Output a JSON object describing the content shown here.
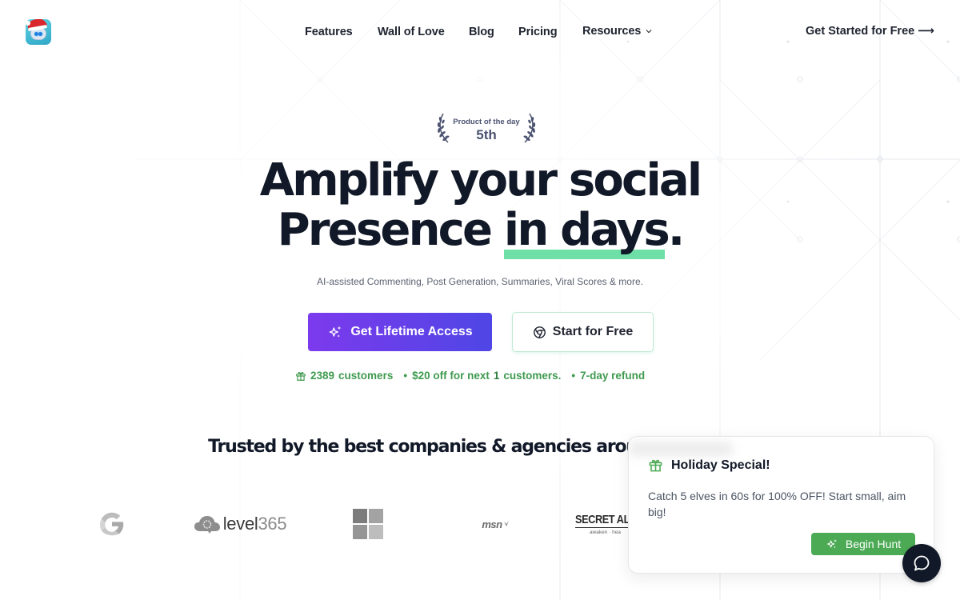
{
  "header": {
    "logo_alt": "App logo (robot with Santa hat)",
    "nav": [
      {
        "label": "Features"
      },
      {
        "label": "Wall of Love"
      },
      {
        "label": "Blog"
      },
      {
        "label": "Pricing"
      },
      {
        "label": "Resources",
        "has_dropdown": true
      }
    ],
    "cta_label": "Get Started for Free",
    "cta_arrow": "⟶"
  },
  "badge": {
    "title": "Product of the day",
    "rank": "5th"
  },
  "hero": {
    "title_line1": "Amplify your social",
    "title_line2_plain": "Presence ",
    "title_line2_highlight": "in days",
    "title_line2_end": ".",
    "highlight_color": "#6ee0a7",
    "subtitle": "AI-assisted Commenting, Post Generation, Summaries, Viral Scores & more.",
    "primary_button": "Get Lifetime Access",
    "secondary_button": "Start for Free",
    "primary_gradient": [
      "#7c3aed",
      "#4f46e5"
    ]
  },
  "stats": {
    "customers_count": "2389",
    "customers_label": "customers",
    "discount_prefix": "$20 off for next",
    "discount_count": "1",
    "discount_suffix": "customers.",
    "refund": "7-day refund",
    "bullet": "•",
    "color": "#3f9a4f"
  },
  "trusted": {
    "heading": "Trusted by the best companies & agencies around the world",
    "logos": [
      {
        "name": "Google",
        "text": "G"
      },
      {
        "name": "level365",
        "text_main": "level",
        "text_num": "365"
      },
      {
        "name": "Microsoft"
      },
      {
        "name": "MSN",
        "text": "msn"
      },
      {
        "name": "Secret Alchemist",
        "text": "SECRET AL",
        "tagline": "awaken · hea"
      },
      {
        "name": "blurred-logo"
      }
    ]
  },
  "popup": {
    "title": "Holiday Special!",
    "body": "Catch 5 elves in 60s for 100% OFF! Start small, aim big!",
    "button": "Begin Hunt",
    "button_color": "#4caa55"
  },
  "chat": {
    "icon": "chat-bubble-icon"
  }
}
